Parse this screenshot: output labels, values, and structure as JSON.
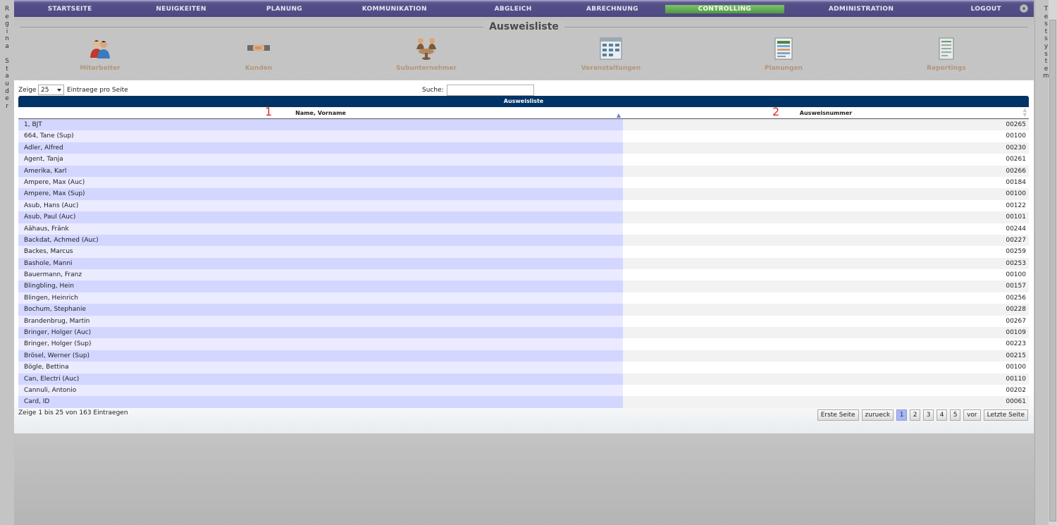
{
  "left_sidebar": {
    "letters": [
      "R",
      "e",
      "g",
      "i",
      "n",
      "a",
      " ",
      "S",
      "t",
      "a",
      "u",
      "d",
      "e",
      "r"
    ]
  },
  "right_sidebar": {
    "letters": [
      "T",
      "e",
      "s",
      "t",
      "s",
      "y",
      "s",
      "t",
      "e",
      "m"
    ]
  },
  "nav": {
    "items": [
      {
        "label": "STARTSEITE"
      },
      {
        "label": "NEUIGKEITEN"
      },
      {
        "label": "PLANUNG"
      },
      {
        "label": "KOMMUNIKATION"
      },
      {
        "label": "ABGLEICH"
      },
      {
        "label": "ABRECHNUNG"
      },
      {
        "label": "CONTROLLING",
        "active": true
      },
      {
        "label": "ADMINISTRATION"
      },
      {
        "label": "LOGOUT"
      }
    ],
    "active_color": "#5fab50",
    "bar_color": "#4f4a82"
  },
  "page_title": "Ausweisliste",
  "modules": [
    {
      "label": "Mitarbeiter",
      "icon": "people-icon"
    },
    {
      "label": "Kunden",
      "icon": "handshake-icon"
    },
    {
      "label": "Subunternehmer",
      "icon": "meeting-icon"
    },
    {
      "label": "Veranstaltungen",
      "icon": "calendar-icon"
    },
    {
      "label": "Planungen",
      "icon": "schedule-icon"
    },
    {
      "label": "Reportings",
      "icon": "report-icon"
    }
  ],
  "controls": {
    "show_label": "Zeige",
    "page_size": "25",
    "per_page_label": "Eintraege pro Seite",
    "search_label": "Suche:",
    "search_value": ""
  },
  "table": {
    "caption": "Ausweisliste",
    "caption_color": "#003366",
    "columns": [
      {
        "label": "Name, Vorname",
        "marker": "1"
      },
      {
        "label": "Ausweisnummer",
        "marker": "2"
      }
    ],
    "rows": [
      {
        "name": "1, BJT",
        "id": "00265"
      },
      {
        "name": "664, Tane (Sup)",
        "id": "00100"
      },
      {
        "name": "Adler, Alfred",
        "id": "00230"
      },
      {
        "name": "Agent, Tanja",
        "id": "00261"
      },
      {
        "name": "Amerika, Karl",
        "id": "00266"
      },
      {
        "name": "Ampere, Max (Auc)",
        "id": "00184"
      },
      {
        "name": "Ampere, Max (Sup)",
        "id": "00100"
      },
      {
        "name": "Asub, Hans (Auc)",
        "id": "00122"
      },
      {
        "name": "Asub, Paul (Auc)",
        "id": "00101"
      },
      {
        "name": "Aähaus, Fränk",
        "id": "00244"
      },
      {
        "name": "Backdat, Achmed (Auc)",
        "id": "00227"
      },
      {
        "name": "Backes, Marcus",
        "id": "00259"
      },
      {
        "name": "Bashole, Manni",
        "id": "00253"
      },
      {
        "name": "Bauermann, Franz",
        "id": "00100"
      },
      {
        "name": "Blingbling, Hein",
        "id": "00157"
      },
      {
        "name": "Blingen, Heinrich",
        "id": "00256"
      },
      {
        "name": "Bochum, Stephanie",
        "id": "00228"
      },
      {
        "name": "Brandenbrug, Martin",
        "id": "00267"
      },
      {
        "name": "Bringer, Holger (Auc)",
        "id": "00109"
      },
      {
        "name": "Bringer, Holger (Sup)",
        "id": "00223"
      },
      {
        "name": "Brösel, Werner (Sup)",
        "id": "00215"
      },
      {
        "name": "Bögle, Bettina",
        "id": "00100"
      },
      {
        "name": "Can, Electri (Auc)",
        "id": "00110"
      },
      {
        "name": "Cannuli, Antonio",
        "id": "00202"
      },
      {
        "name": "Card, ID",
        "id": "00061"
      }
    ]
  },
  "footer": {
    "info": "Zeige 1 bis 25 von 163 Eintraegen",
    "first": "Erste Seite",
    "prev": "zurueck",
    "pages": [
      "1",
      "2",
      "3",
      "4",
      "5"
    ],
    "current_page": "1",
    "next": "vor",
    "last": "Letzte Seite"
  }
}
